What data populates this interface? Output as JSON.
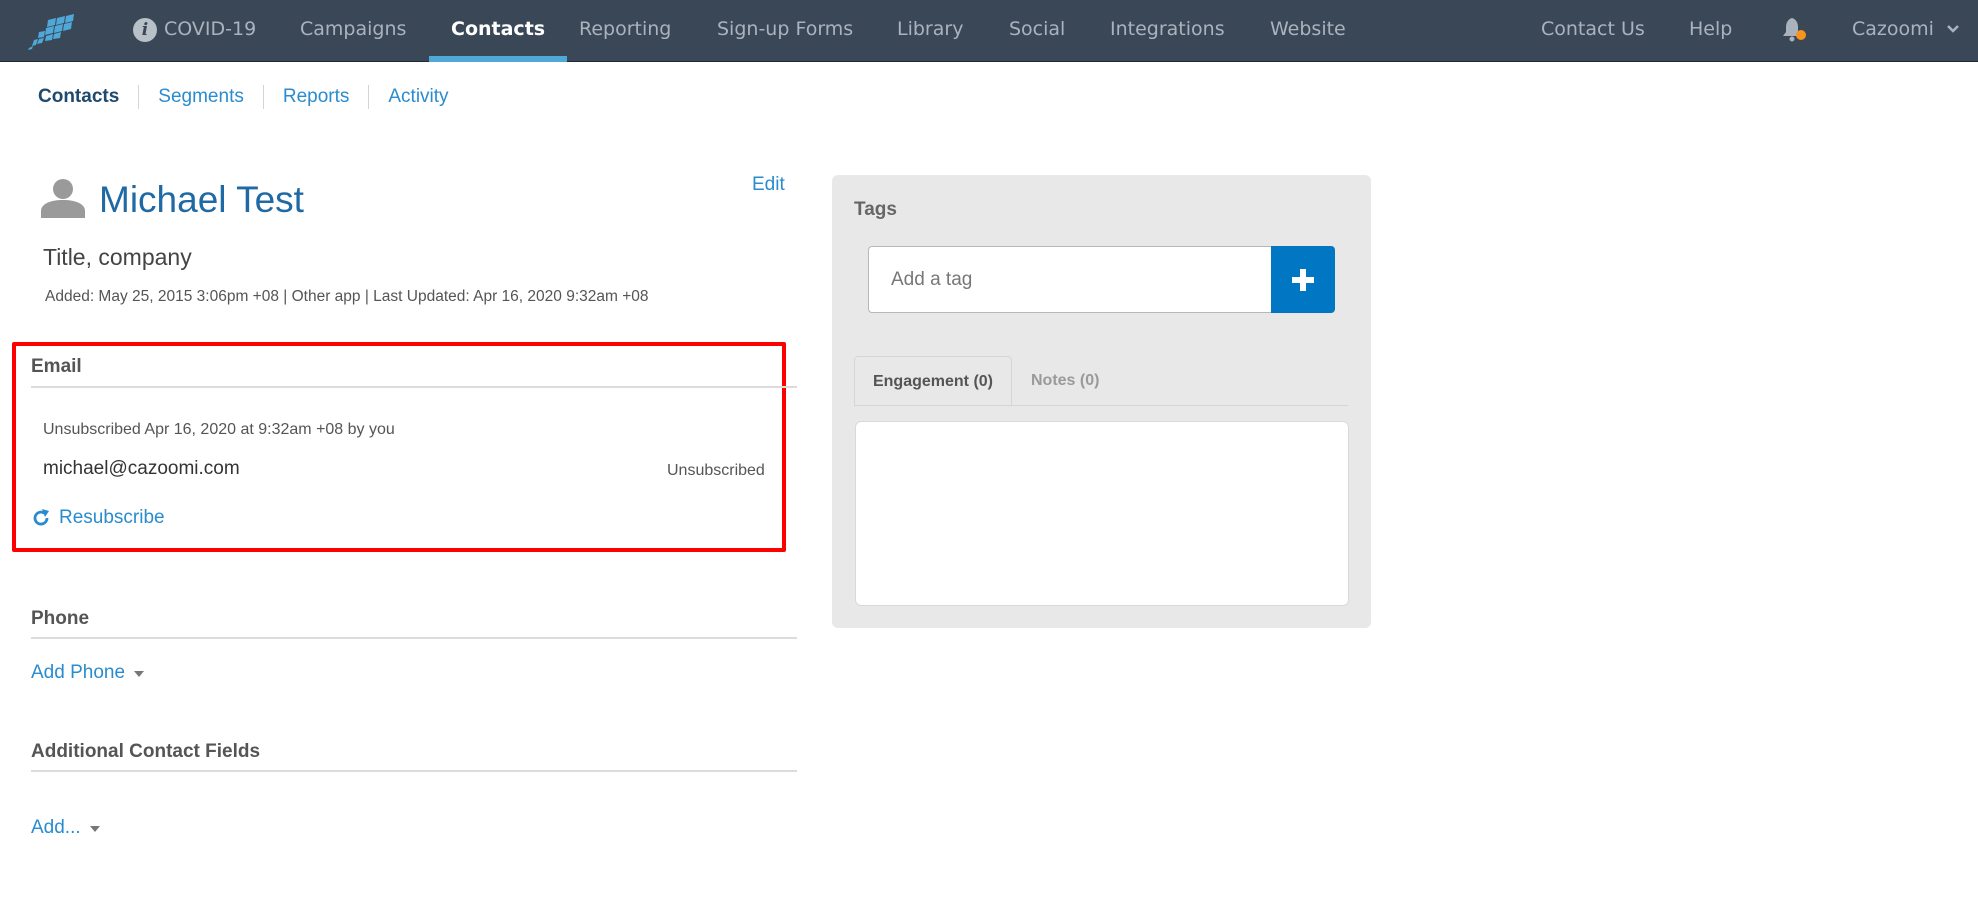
{
  "topnav": {
    "logo": "cazoomi-logo",
    "items": [
      {
        "label": "COVID-19",
        "icon": "info-icon"
      },
      {
        "label": "Campaigns"
      },
      {
        "label": "Contacts",
        "active": true
      },
      {
        "label": "Reporting"
      },
      {
        "label": "Sign-up Forms"
      },
      {
        "label": "Library"
      },
      {
        "label": "Social"
      },
      {
        "label": "Integrations"
      },
      {
        "label": "Website"
      }
    ],
    "right_items": [
      {
        "label": "Contact Us"
      },
      {
        "label": "Help"
      }
    ],
    "notifications_icon": "bell-icon",
    "account_label": "Cazoomi",
    "account_icon": "chevron-down-icon",
    "info_glyph": "i"
  },
  "subnav": {
    "items": [
      {
        "label": "Contacts",
        "active": true
      },
      {
        "label": "Segments"
      },
      {
        "label": "Reports"
      },
      {
        "label": "Activity"
      }
    ]
  },
  "contact": {
    "name": "Michael Test",
    "edit_label": "Edit",
    "title_company": "Title, company",
    "meta": "Added: May 25, 2015 3:06pm +08 | Other app | Last Updated: Apr 16, 2020 9:32am +08"
  },
  "email_section": {
    "heading": "Email",
    "unsubscribe_note": "Unsubscribed Apr 16, 2020 at 9:32am +08 by you",
    "address": "michael@cazoomi.com",
    "status": "Unsubscribed",
    "resubscribe_label": "Resubscribe"
  },
  "phone_section": {
    "heading": "Phone",
    "add_label": "Add Phone"
  },
  "additional_section": {
    "heading": "Additional Contact Fields",
    "add_label": "Add..."
  },
  "tags_panel": {
    "label": "Tags",
    "input_placeholder": "Add a tag",
    "input_value": "",
    "tabs": [
      {
        "label": "Engagement (0)",
        "active": true
      },
      {
        "label": "Notes (0)",
        "active": false
      }
    ]
  },
  "colors": {
    "nav_bg": "#3a4757",
    "active_underline": "#4fa8d8",
    "link": "#2a8ccf",
    "primary_button": "#0176c3",
    "highlight": "#ff0000",
    "notification_dot": "#f7941d"
  }
}
